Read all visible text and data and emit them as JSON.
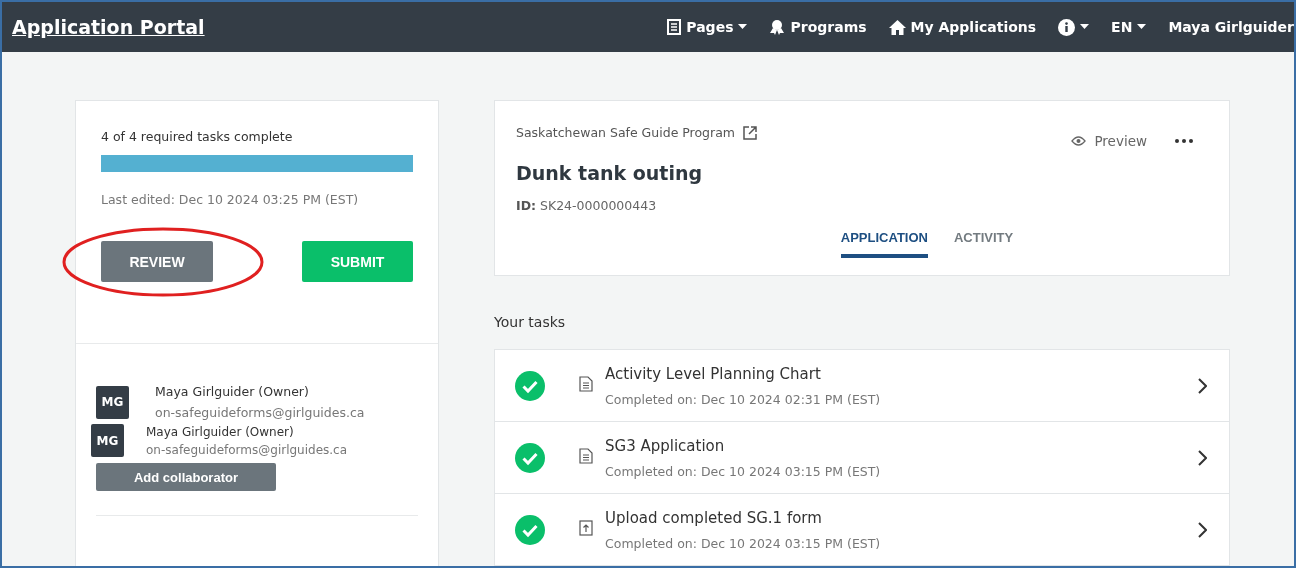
{
  "header": {
    "title": "Application Portal",
    "nav": [
      {
        "kind": "pages",
        "label": "Pages",
        "caret": true
      },
      {
        "kind": "programs",
        "label": "Programs",
        "caret": false
      },
      {
        "kind": "home",
        "label": "My Applications",
        "caret": false
      },
      {
        "kind": "info",
        "caret": true
      },
      {
        "kind": "text",
        "label": "EN",
        "caret": true
      },
      {
        "kind": "text",
        "label": "Maya Girlguider",
        "caret": false
      }
    ]
  },
  "status_card": {
    "summary": "4 of 4 required tasks complete",
    "level": 1,
    "last_edited": "Last edited: Dec 10 2024 03:25 PM (EST)",
    "review_button": "REVIEW",
    "submit_button": "SUBMIT",
    "highlighted": true
  },
  "collaborators": [
    {
      "initials": "MG",
      "name": "Maya Girlguider (Owner)",
      "email": "on-safeguideforms@girlguides.ca"
    }
  ],
  "overlay_collaborator": {
    "initials": "MG",
    "name": "Maya Girlguider (Owner)",
    "email": "on-safeguideforms@girlguides.ca"
  },
  "add_collaborator_button": "Add collaborator",
  "application": {
    "program": "Saskatchewan Safe Guide Program",
    "preview": "Preview",
    "title": "Dunk tank outing",
    "id_label": "ID:",
    "id": "SK24-0000000443",
    "tabs": [
      {
        "label": "APPLICATION",
        "selected": true
      },
      {
        "label": "ACTIVITY",
        "selected": false
      }
    ]
  },
  "tasks_heading": "Your tasks",
  "tasks": [
    {
      "kind": "form",
      "title": "Activity Level Planning Chart",
      "completed": "Completed on: Dec 10 2024 02:31 PM (EST)",
      "done": true
    },
    {
      "kind": "form",
      "title": "SG3 Application",
      "completed": "Completed on: Dec 10 2024 03:15 PM (EST)",
      "done": true
    },
    {
      "kind": "upload",
      "title": "Upload completed SG.1 form",
      "completed": "Completed on: Dec 10 2024 03:15 PM (EST)",
      "done": true
    }
  ]
}
